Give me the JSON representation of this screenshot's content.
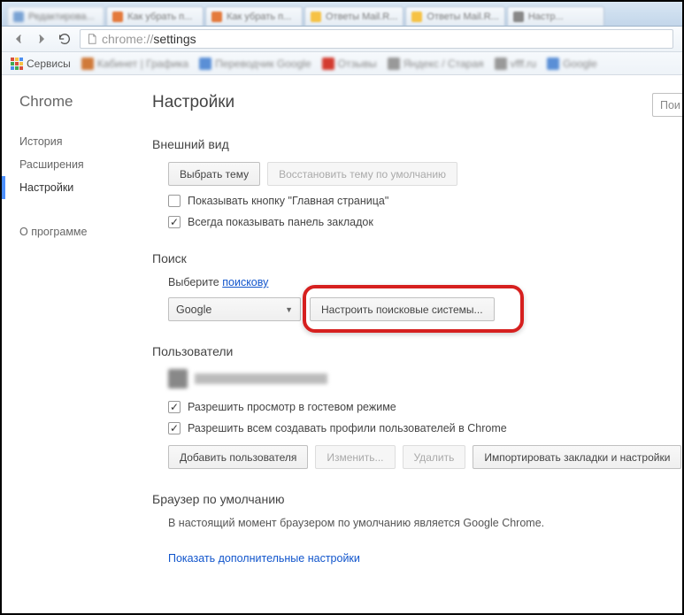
{
  "browser": {
    "url_protocol": "chrome://",
    "url_path": "settings",
    "bookmarks_bar_label": "Сервисы"
  },
  "sidebar": {
    "brand": "Chrome",
    "items": [
      {
        "label": "История"
      },
      {
        "label": "Расширения"
      },
      {
        "label": "Настройки"
      },
      {
        "label": "О программе"
      }
    ]
  },
  "main": {
    "title": "Настройки",
    "search_placeholder": "Пои",
    "appearance": {
      "heading": "Внешний вид",
      "choose_theme_btn": "Выбрать тему",
      "restore_theme_btn": "Восстановить тему по умолчанию",
      "show_home_btn": "Показывать кнопку \"Главная страница\"",
      "always_show_bookmarks": "Всегда показывать панель закладок"
    },
    "search": {
      "heading": "Поиск",
      "desc_prefix": "Выберите ",
      "desc_link": "поискову",
      "selected_engine": "Google",
      "configure_btn": "Настроить поисковые системы..."
    },
    "users": {
      "heading": "Пользователи",
      "guest_mode": "Разрешить просмотр в гостевом режиме",
      "allow_create": "Разрешить всем создавать профили пользователей в Chrome",
      "add_user_btn": "Добавить пользователя",
      "edit_btn": "Изменить...",
      "delete_btn": "Удалить",
      "import_btn": "Импортировать закладки и настройки"
    },
    "default_browser": {
      "heading": "Браузер по умолчанию",
      "status": "В настоящий момент браузером по умолчанию является Google Chrome."
    },
    "show_advanced": "Показать дополнительные настройки"
  }
}
